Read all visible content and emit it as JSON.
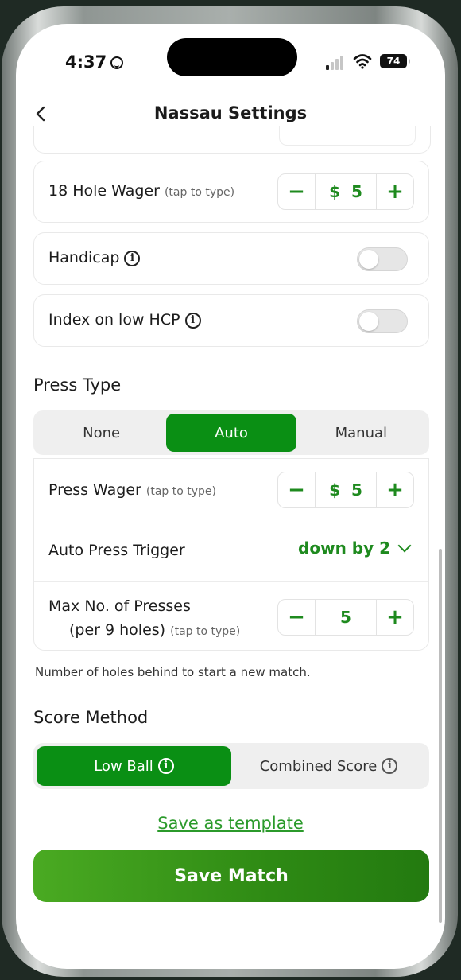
{
  "status_bar": {
    "time": "4:37",
    "battery": "74"
  },
  "nav": {
    "title": "Nassau Settings"
  },
  "wager_18": {
    "label": "18 Hole Wager",
    "hint": "(tap to type)",
    "currency": "$",
    "value": "5",
    "minus": "−",
    "plus": "+"
  },
  "handicap": {
    "label": "Handicap",
    "info": "i",
    "enabled": false
  },
  "index_low": {
    "label": "Index on low HCP",
    "info": "i",
    "enabled": false
  },
  "press_type": {
    "title": "Press Type",
    "options": [
      "None",
      "Auto",
      "Manual"
    ],
    "selected": "Auto"
  },
  "press_wager": {
    "label": "Press Wager",
    "hint": "(tap to type)",
    "currency": "$",
    "value": "5",
    "minus": "−",
    "plus": "+"
  },
  "auto_trigger": {
    "label": "Auto Press Trigger",
    "value": "down by 2"
  },
  "max_presses": {
    "label_line1": "Max No. of Presses",
    "label_line2": "(per 9 holes)",
    "hint": "(tap to type)",
    "value": "5",
    "minus": "−",
    "plus": "+"
  },
  "note": "Number of holes behind to start a new match.",
  "score_method": {
    "title": "Score Method",
    "options": [
      "Low Ball",
      "Combined Score"
    ],
    "selected": "Low Ball",
    "info": "i"
  },
  "actions": {
    "save_template": "Save as template",
    "save_match": "Save Match"
  },
  "colors": {
    "accent": "#0a8f14",
    "accent_text": "#1e8a1e"
  }
}
